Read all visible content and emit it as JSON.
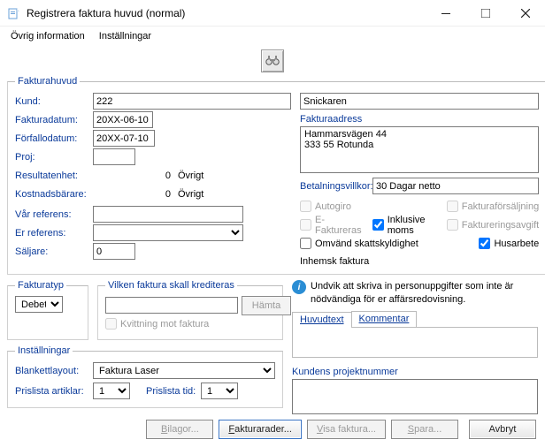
{
  "window": {
    "title": "Registrera faktura huvud (normal)"
  },
  "menu": {
    "ovrig": "Övrig information",
    "installningar": "Inställningar"
  },
  "fh": {
    "legend": "Fakturahuvud",
    "kund_lbl": "Kund:",
    "kund_val": "222",
    "kundnamn": "Snickaren",
    "faktdat_lbl": "Fakturadatum:",
    "faktdat_val": "20XX-06-10",
    "forfdat_lbl": "Förfallodatum:",
    "forfdat_val": "20XX-07-10",
    "proj_lbl": "Proj:",
    "proj_val": "",
    "res_lbl": "Resultatenhet:",
    "res_code": "0",
    "res_txt": "Övrigt",
    "kost_lbl": "Kostnadsbärare:",
    "kost_code": "0",
    "kost_txt": "Övrigt",
    "varref_lbl": "Vår referens:",
    "varref_val": "",
    "erref_lbl": "Er referens:",
    "erref_val": "",
    "salj_lbl": "Säljare:",
    "salj_val": "0",
    "adr_lbl": "Fakturaadress",
    "adr_l1": "Hammarsvägen 44",
    "adr_l2": "333 55 Rotunda",
    "betv_lbl": "Betalningsvillkor:",
    "betv_val": "30 Dagar netto",
    "cb_autogiro": "Autogiro",
    "cb_efakt": "E-Faktureras",
    "cb_inkmoms": "Inklusive moms",
    "cb_omvskt": "Omvänd skattskyldighet",
    "cb_faktfors": "Fakturaförsäljning",
    "cb_faktavg": "Faktureringsavgift",
    "cb_husarb": "Husarbete",
    "inhemsk": "Inhemsk faktura"
  },
  "ftyp": {
    "legend": "Fakturatyp",
    "val": "Debet"
  },
  "kredit": {
    "legend": "Vilken faktura skall krediteras",
    "hamta": "Hämta",
    "kvitt": "Kvittning mot faktura"
  },
  "inst": {
    "legend": "Inställningar",
    "blank_lbl": "Blankettlayout:",
    "blank_val": "Faktura Laser",
    "paart_lbl": "Prislista artiklar:",
    "paart_val": "1",
    "patid_lbl": "Prislista tid:",
    "patid_val": "1"
  },
  "info": {
    "text": "Undvik att skriva in personuppgifter som inte är nödvändiga för er affärsredovisning.",
    "tab_huvud": "Huvudtext",
    "tab_komm": "Kommentar",
    "projnr_lbl": "Kundens projektnummer",
    "projnr_val": ""
  },
  "footer": {
    "bilagor": "Bilagor...",
    "fakturarader": "Fakturarader...",
    "visa": "Visa faktura...",
    "spara": "Spara...",
    "avbryt": "Avbryt"
  }
}
